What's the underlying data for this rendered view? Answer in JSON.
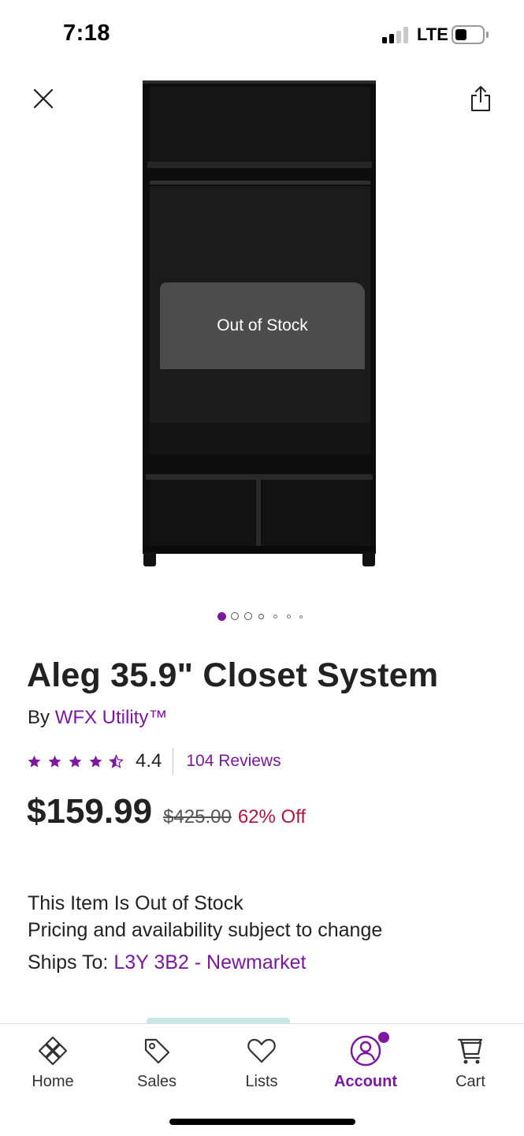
{
  "status_bar": {
    "time": "7:18",
    "network": "LTE",
    "signal_bars": 2,
    "signal_bars_max": 4,
    "battery_level": 0.3
  },
  "header": {
    "close_icon": "close-icon",
    "share_icon": "share-icon"
  },
  "product_image": {
    "overlay_text": "Out of Stock",
    "carousel": {
      "count": 7,
      "active_index": 0
    }
  },
  "product": {
    "title": "Aleg 35.9\" Closet System",
    "by_label": "By",
    "brand": "WFX Utility™",
    "rating": {
      "value": "4.4",
      "stars": 4.5,
      "reviews_label": "104 Reviews"
    },
    "price": "$159.99",
    "original_price": "$425.00",
    "discount": "62% Off",
    "availability": "This Item Is Out of Stock",
    "pricing_note": "Pricing and availability subject to change",
    "ships_to_label": "Ships To:",
    "ships_to_value": "L3Y 3B2 - Newmarket"
  },
  "bottom_nav": {
    "items": [
      {
        "label": "Home",
        "icon": "home-icon"
      },
      {
        "label": "Sales",
        "icon": "tag-icon"
      },
      {
        "label": "Lists",
        "icon": "heart-icon"
      },
      {
        "label": "Account",
        "icon": "account-icon",
        "active": true,
        "badge": true
      },
      {
        "label": "Cart",
        "icon": "cart-icon"
      }
    ]
  },
  "colors": {
    "accent": "#7b189f",
    "discount": "#b0163f",
    "text": "#222222"
  }
}
